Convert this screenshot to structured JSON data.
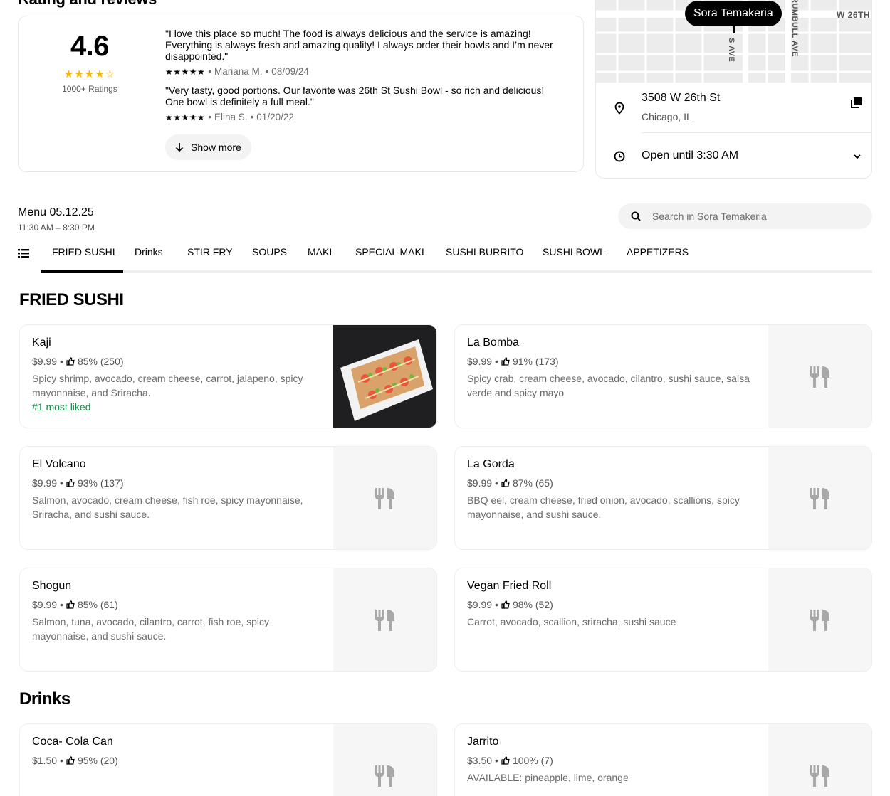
{
  "ratings": {
    "section_title": "Rating and reviews",
    "score": "4.6",
    "stars": "★★★★☆",
    "count_label": "1000+ Ratings",
    "reviews": [
      {
        "text": "\"I love this place so much! The food is always delicious and the service is amazing! Everything is always fresh and amazing quality! I always order their bowls and I’m never disappointed.\"",
        "stars": "★★★★★",
        "author": "Mariana M.",
        "date": "08/09/24"
      },
      {
        "text": "\"Very tasty, good portions. Our favorite was 26th St Sushi Bowl - so rich and delicious! One bowl is definitely a full meal.\"",
        "stars": "★★★★★",
        "author": "Elina S.",
        "date": "01/20/22"
      }
    ],
    "show_more_label": "Show more",
    "star_color": "#f5b400"
  },
  "store": {
    "name": "Sora Temakeria",
    "map_labels": {
      "street_1": "W 26TH",
      "street_2": "S AVE",
      "street_3": "RUMBULL AVE"
    },
    "address_line1": "3508 W 26th St",
    "address_line2": "Chicago, IL",
    "hours": "Open until 3:30 AM"
  },
  "menu": {
    "title": "Menu 05.12.25",
    "hours": "11:30 AM – 8:30 PM",
    "search_placeholder": "Search in Sora Temakeria",
    "tabs": [
      {
        "label": "FRIED SUSHI"
      },
      {
        "label": "Drinks"
      },
      {
        "label": "STIR FRY"
      },
      {
        "label": "SOUPS"
      },
      {
        "label": "MAKI"
      },
      {
        "label": "SPECIAL MAKI"
      },
      {
        "label": "SUSHI BURRITO"
      },
      {
        "label": "SUSHI BOWL"
      },
      {
        "label": "APPETIZERS"
      }
    ]
  },
  "categories": {
    "fried_sushi": {
      "title": "FRIED SUSHI",
      "items": [
        {
          "name": "Kaji",
          "price": "$9.99",
          "likes": "85% (250)",
          "desc": "Spicy shrimp, avocado, cream cheese, carrot, jalapeno, spicy mayonnaise, and Sriracha.",
          "badge": "#1 most liked"
        },
        {
          "name": "La Bomba",
          "price": "$9.99",
          "likes": "91% (173)",
          "desc": "Spicy crab, cream cheese, avocado, cilantro, sushi sauce, salsa verde and spicy mayo"
        },
        {
          "name": "El Volcano",
          "price": "$9.99",
          "likes": "93% (137)",
          "desc": "Salmon, avocado, cream cheese, fish roe, spicy mayonnaise, Sriracha, and sushi sauce."
        },
        {
          "name": "La Gorda",
          "price": "$9.99",
          "likes": "87% (65)",
          "desc": "BBQ eel, cream cheese, fried onion, avocado, scallions, spicy mayonnaise, and sushi sauce."
        },
        {
          "name": "Shogun",
          "price": "$9.99",
          "likes": "85% (61)",
          "desc": "Salmon, tuna, avocado, cilantro, carrot, fish roe, spicy mayonnaise, and sushi sauce."
        },
        {
          "name": "Vegan Fried Roll",
          "price": "$9.99",
          "likes": "98% (52)",
          "desc": "Carrot, avocado, scallion, sriracha, sushi sauce"
        }
      ]
    },
    "drinks": {
      "title": "Drinks",
      "items": [
        {
          "name": "Coca- Cola Can",
          "price": "$1.50",
          "likes": "95% (20)",
          "desc": ""
        },
        {
          "name": "Jarrito",
          "price": "$3.50",
          "likes": "100% (7)",
          "desc": "AVAILABLE: pineapple, lime, orange"
        }
      ]
    }
  },
  "sep": "•",
  "badge_color": "#138a45"
}
